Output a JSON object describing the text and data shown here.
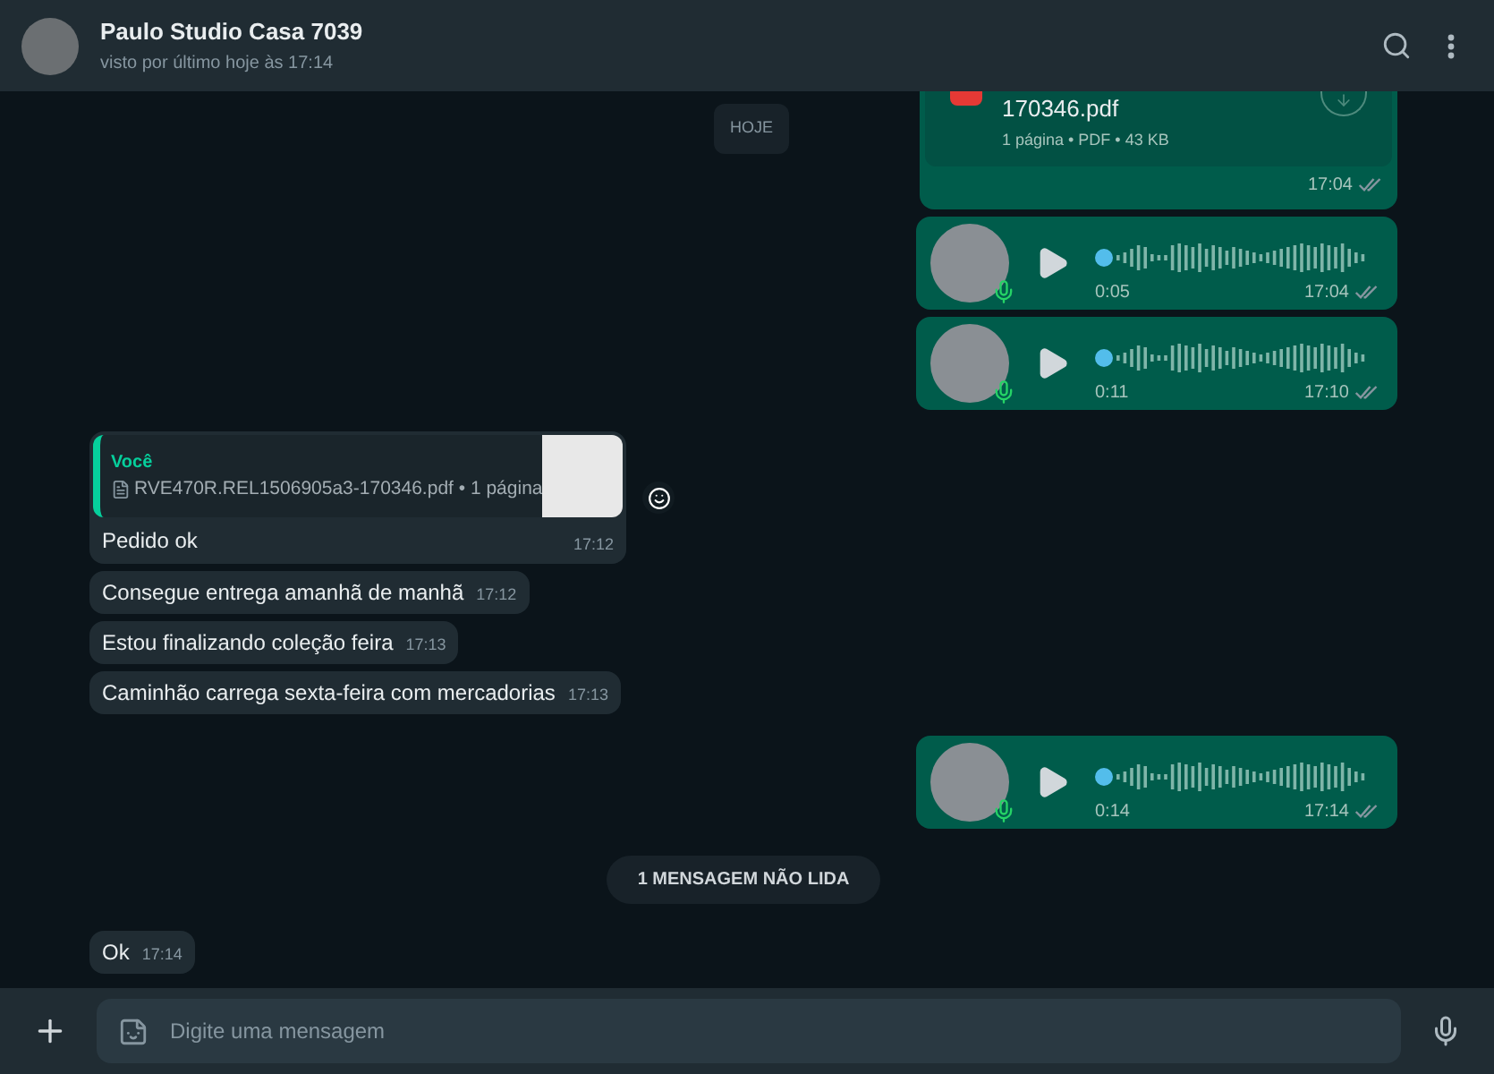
{
  "header": {
    "name": "Paulo Studio Casa 7039",
    "status": "visto por último hoje às 17:14"
  },
  "date_chip": "HOJE",
  "messages": [
    {
      "kind": "document",
      "outgoing": true,
      "file_name": "170346.pdf",
      "file_meta": "1 página • PDF • 43 KB",
      "time": "17:04",
      "read": false
    },
    {
      "kind": "voice",
      "outgoing": true,
      "duration": "0:05",
      "time": "17:04",
      "read": false
    },
    {
      "kind": "voice",
      "outgoing": true,
      "duration": "0:11",
      "time": "17:10",
      "read": false
    },
    {
      "kind": "quoted",
      "outgoing": false,
      "quote_author": "Você",
      "quote_file": "RVE470R.REL1506905a3-170346.pdf • 1 página",
      "text": "Pedido ok",
      "time": "17:12"
    },
    {
      "kind": "text",
      "outgoing": false,
      "text": "Consegue entrega amanhã de manhã",
      "time": "17:12"
    },
    {
      "kind": "text",
      "outgoing": false,
      "text": "Estou finalizando coleção feira",
      "time": "17:13"
    },
    {
      "kind": "text",
      "outgoing": false,
      "text": "Caminhão carrega sexta-feira com mercadorias",
      "time": "17:13"
    },
    {
      "kind": "voice",
      "outgoing": true,
      "duration": "0:14",
      "time": "17:14",
      "read": false
    },
    {
      "kind": "divider",
      "text": "1 MENSAGEM NÃO LIDA"
    },
    {
      "kind": "text",
      "outgoing": false,
      "text": "Ok",
      "time": "17:14"
    }
  ],
  "composer": {
    "placeholder": "Digite uma mensagem"
  }
}
